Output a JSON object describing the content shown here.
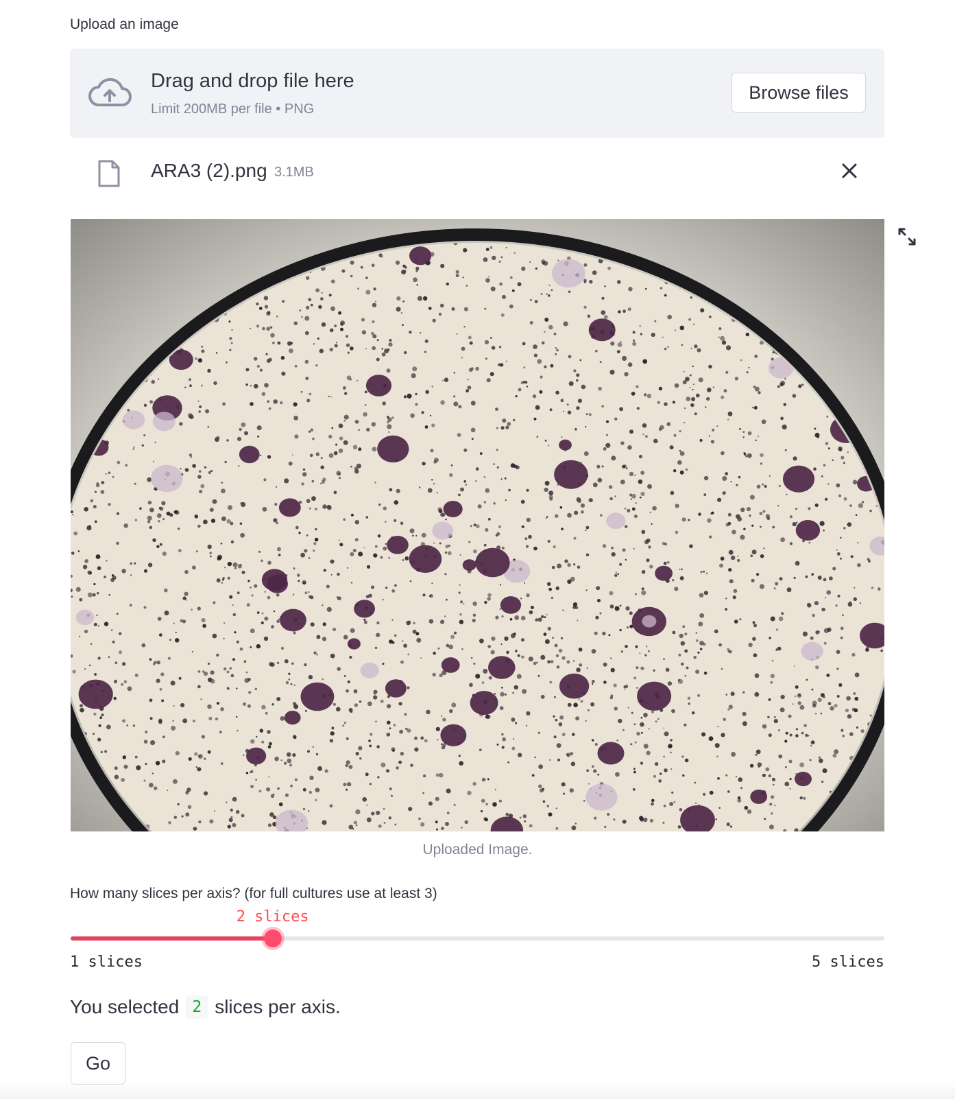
{
  "uploader": {
    "label": "Upload an image",
    "drop_title": "Drag and drop file here",
    "limit_text": "Limit 200MB per file • PNG",
    "browse_label": "Browse files",
    "icon": "cloud-upload-icon"
  },
  "file": {
    "name": "ARA3 (2).png",
    "size": "3.1MB",
    "icon": "file-icon",
    "remove_icon": "close-icon"
  },
  "image": {
    "caption": "Uploaded Image.",
    "expand_icon": "fullscreen-icon"
  },
  "slider": {
    "label": "How many slices per axis? (for full cultures use at least 3)",
    "value_label": "2 slices",
    "min_label": "1 slices",
    "max_label": "5 slices",
    "value": 2,
    "min": 1,
    "max": 5,
    "accent_color": "#ff4b4b"
  },
  "result": {
    "prefix": "You selected",
    "value": "2",
    "suffix": "slices per axis."
  },
  "go_button": {
    "label": "Go"
  }
}
